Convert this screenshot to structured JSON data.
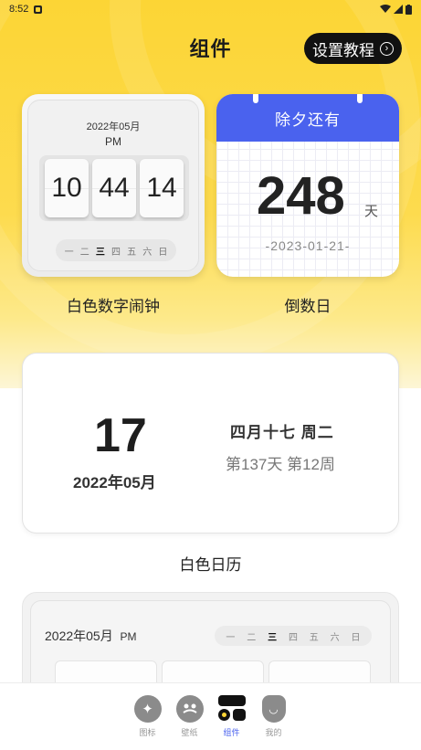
{
  "status_bar": {
    "time": "8:52"
  },
  "header": {
    "title": "组件",
    "tutorial_label": "设置教程",
    "tutorial_chevron": "›"
  },
  "widgets": {
    "clock": {
      "date": "2022年05月",
      "ampm": "PM",
      "hour": "10",
      "minute": "44",
      "second": "14",
      "weekdays": [
        "一",
        "二",
        "三",
        "四",
        "五",
        "六",
        "日"
      ],
      "active_weekday_index": 2,
      "caption": "白色数字闹钟"
    },
    "countdown": {
      "event": "除夕还有",
      "days": "248",
      "unit": "天",
      "target_date": "-2023-01-21-",
      "caption": "倒数日",
      "header_color": "#4a62ee"
    },
    "calendar": {
      "day": "17",
      "month": "2022年05月",
      "lunar": "四月十七  周二",
      "stat": "第137天  第12周",
      "caption": "白色日历"
    },
    "partial": {
      "date": "2022年05月",
      "ampm": "PM",
      "weekdays": [
        "一",
        "二",
        "三",
        "四",
        "五",
        "六",
        "日"
      ],
      "active_weekday_index": 2
    }
  },
  "bottom_nav": {
    "items": [
      {
        "label": "图标",
        "icon": "sparkle-icon"
      },
      {
        "label": "壁纸",
        "icon": "wallpaper-icon"
      },
      {
        "label": "组件",
        "icon": "widget-icon"
      },
      {
        "label": "我的",
        "icon": "profile-icon"
      }
    ],
    "active_index": 2,
    "active_color": "#4a62ee"
  },
  "theme": {
    "accent": "#fcd535"
  }
}
